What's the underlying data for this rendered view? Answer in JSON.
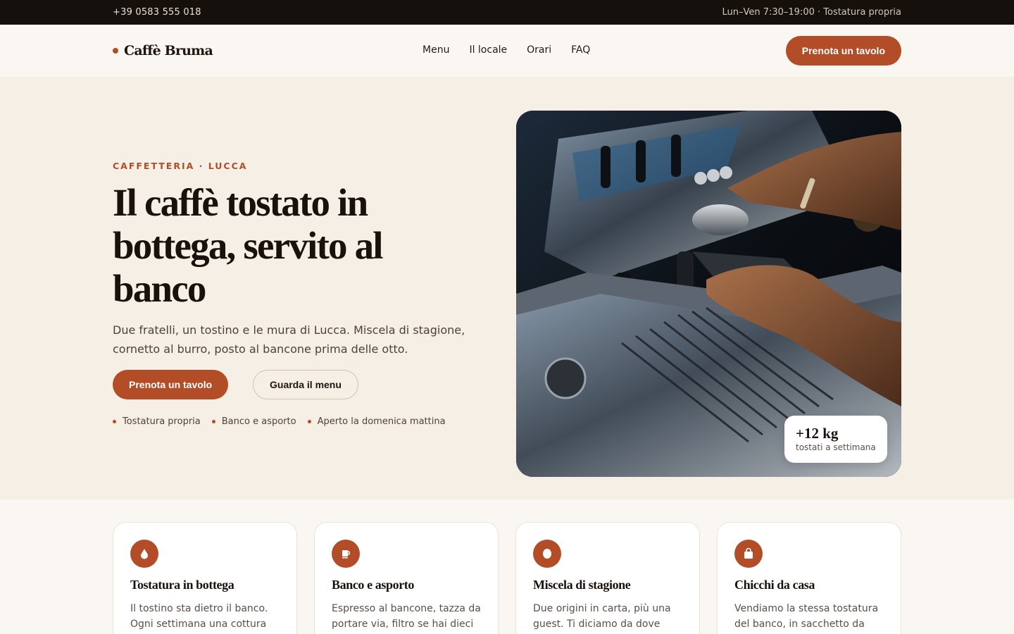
{
  "topbar": {
    "phone": "+39 0583 555 018",
    "hours": "Lun–Ven 7:30–19:00 · Tostatura propria"
  },
  "header": {
    "logo": "Caffè Bruma",
    "nav": [
      "Menu",
      "Il locale",
      "Orari",
      "FAQ"
    ],
    "cta": "Prenota un tavolo"
  },
  "hero": {
    "eyebrow": "CAFFETTERIA · LUCCA",
    "title": "Il caffè tostato in bottega, servito al banco",
    "subtitle": "Due fratelli, un tostino e le mura di Lucca. Miscela di stagione, cornetto al burro, posto al bancone prima delle otto.",
    "primary_button": "Prenota un tavolo",
    "secondary_button": "Guarda il menu",
    "features": [
      "Tostatura propria",
      "Banco e asporto",
      "Aperto la domenica mattina"
    ],
    "image_stat": {
      "value": "+12 kg",
      "label": "tostati a settimana"
    }
  },
  "cards": [
    {
      "icon": "drop-icon",
      "title": "Tostatura in bottega",
      "text": "Il tostino sta dietro il banco. Ogni settimana una cottura"
    },
    {
      "icon": "cup-icon",
      "title": "Banco e asporto",
      "text": "Espresso al bancone, tazza da portare via, filtro se hai dieci"
    },
    {
      "icon": "bean-icon",
      "title": "Miscela di stagione",
      "text": "Due origini in carta, più una guest. Ti diciamo da dove"
    },
    {
      "icon": "bag-icon",
      "title": "Chicchi da casa",
      "text": "Vendiamo la stessa tostatura del banco, in sacchetto da"
    }
  ],
  "colors": {
    "accent": "#b24d28",
    "topbar": "#16100c",
    "hero_bg": "#f6efe6"
  }
}
